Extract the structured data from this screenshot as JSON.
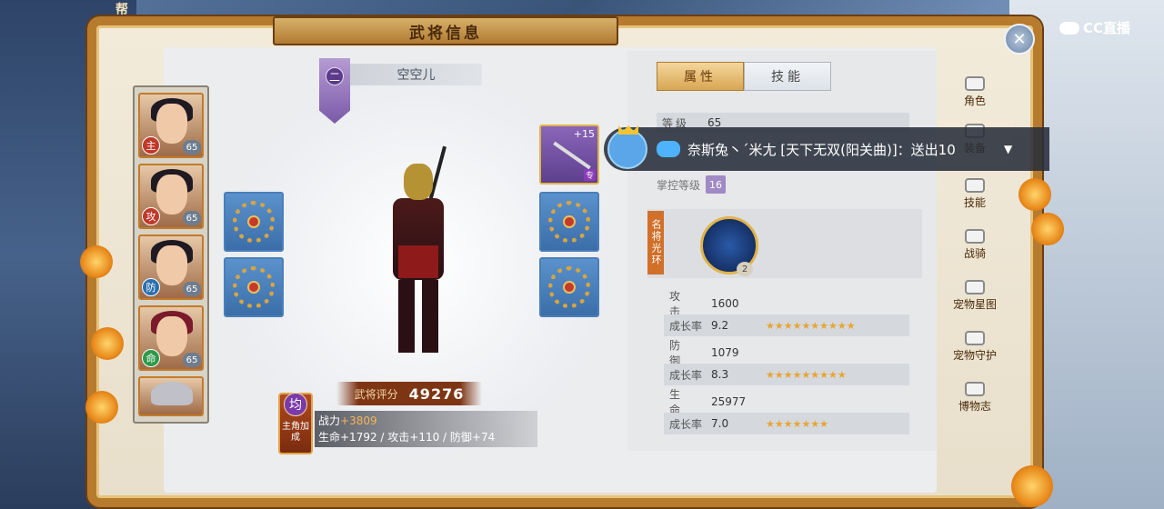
{
  "header": {
    "title": "武将信息",
    "guild_fragment": "帮",
    "watermark": "CC直播"
  },
  "hero_list": [
    {
      "role": "主",
      "role_color": "#c0392b",
      "level": "65"
    },
    {
      "role": "攻",
      "role_color": "#c0392b",
      "level": "65"
    },
    {
      "role": "防",
      "role_color": "#2a6fb0",
      "level": "65"
    },
    {
      "role": "命",
      "role_color": "#2e9a4a",
      "level": "65"
    }
  ],
  "general": {
    "rank": "二",
    "name": "空空儿",
    "score_label": "武将评分",
    "score": "49276",
    "weapon_enhance": "+15",
    "weapon_tag": "专"
  },
  "bonus": {
    "badge": "均",
    "badge_label": "主角加成",
    "power_label": "战力",
    "power_value": "+3809",
    "stats_line": "生命+1792 / 攻击+110 / 防御+74"
  },
  "tabs": {
    "attributes": "属性",
    "skills": "技能"
  },
  "stats": {
    "level_label": "等级",
    "level_value": "65",
    "mastery_label": "掌控等级",
    "mastery_value": "16",
    "aura_label": "名将光环",
    "aura_level": "2"
  },
  "growth": [
    {
      "stat_label": "攻击",
      "stat_value": "1600",
      "rate_label": "成长率",
      "rate_value": "9.2",
      "stars": "★★★★★★★★★★"
    },
    {
      "stat_label": "防御",
      "stat_value": "1079",
      "rate_label": "成长率",
      "rate_value": "8.3",
      "stars": "★★★★★★★★★"
    },
    {
      "stat_label": "生命",
      "stat_value": "25977",
      "rate_label": "成长率",
      "rate_value": "7.0",
      "stars": "★★★★★★★"
    }
  ],
  "side_nav": [
    "角色",
    "装备",
    "技能",
    "战骑",
    "宠物星图",
    "宠物守护",
    "博物志"
  ],
  "chat": {
    "message": "奈斯兔丶´米尢 [天下无双(阳关曲)]：送出10"
  },
  "colors": {
    "frame": "#b77b2e",
    "accent_gold": "#d8a653",
    "star": "#e8a530"
  }
}
